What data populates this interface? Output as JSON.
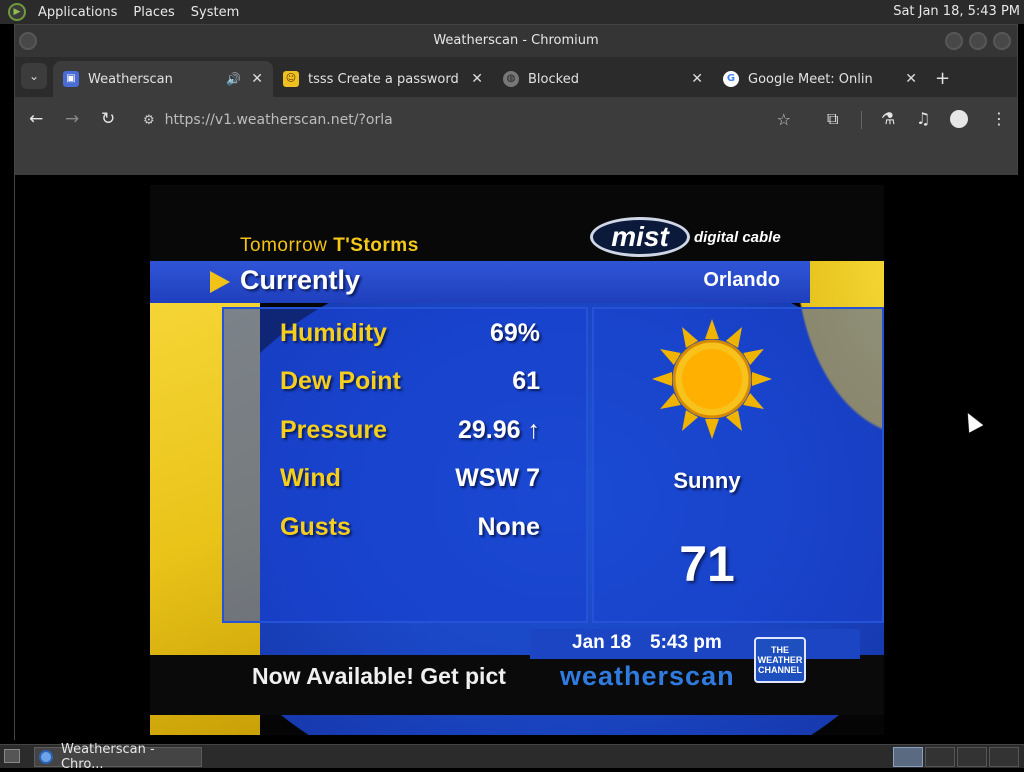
{
  "top_panel": {
    "menus": [
      "Applications",
      "Places",
      "System"
    ],
    "clock": "Sat Jan 18,  5:43 PM"
  },
  "window": {
    "title": "Weatherscan - Chromium"
  },
  "tabs": [
    {
      "title": "Weatherscan",
      "favicon": "weatherscan-favicon",
      "active": true,
      "audio": true
    },
    {
      "title": "tsss Create a password-p",
      "favicon": "emoji-favicon",
      "active": false
    },
    {
      "title": "Blocked",
      "favicon": "globe-icon",
      "active": false
    },
    {
      "title": "Google Meet: Online Web",
      "favicon": "google-icon",
      "active": false
    }
  ],
  "toolbar": {
    "url": "https://v1.weatherscan.net/?orla"
  },
  "weatherscan": {
    "forecast_prefix": "Tomorrow",
    "forecast_condition": "T'Storms",
    "logo_main": "mist",
    "logo_sub": "digital cable",
    "current_label": "Currently",
    "city": "Orlando",
    "readings": [
      {
        "label": "Humidity",
        "value": "69%"
      },
      {
        "label": "Dew Point",
        "value": "61"
      },
      {
        "label": "Pressure",
        "value": "29.96 ↑"
      },
      {
        "label": "Wind",
        "value": "WSW 7"
      },
      {
        "label": "Gusts",
        "value": "None"
      }
    ],
    "condition": "Sunny",
    "temperature": "71",
    "date": "Jan 18",
    "time": "5:43 pm",
    "ticker": "Now Available! Get pict",
    "brand": "weatherscan",
    "channel_logo": "THE WEATHER CHANNEL",
    "colors": {
      "yellow": "#f2c316",
      "blue": "#1f3fbd",
      "brand_blue": "#2f7be0"
    }
  },
  "taskbar": {
    "task_label": "Weatherscan - Chro..."
  }
}
